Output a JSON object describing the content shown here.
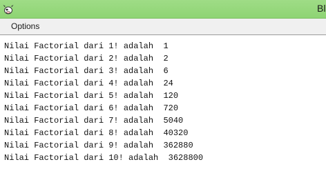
{
  "window": {
    "title": "Bl",
    "icon": "cow-icon",
    "titlebar_color": "#8ed474"
  },
  "menu": {
    "items": [
      {
        "label": "Options"
      }
    ]
  },
  "output": {
    "lines": [
      "Nilai Factorial dari 1! adalah  1",
      "Nilai Factorial dari 2! adalah  2",
      "Nilai Factorial dari 3! adalah  6",
      "Nilai Factorial dari 4! adalah  24",
      "Nilai Factorial dari 5! adalah  120",
      "Nilai Factorial dari 6! adalah  720",
      "Nilai Factorial dari 7! adalah  5040",
      "Nilai Factorial dari 8! adalah  40320",
      "Nilai Factorial dari 9! adalah  362880",
      "Nilai Factorial dari 10! adalah  3628800"
    ]
  }
}
